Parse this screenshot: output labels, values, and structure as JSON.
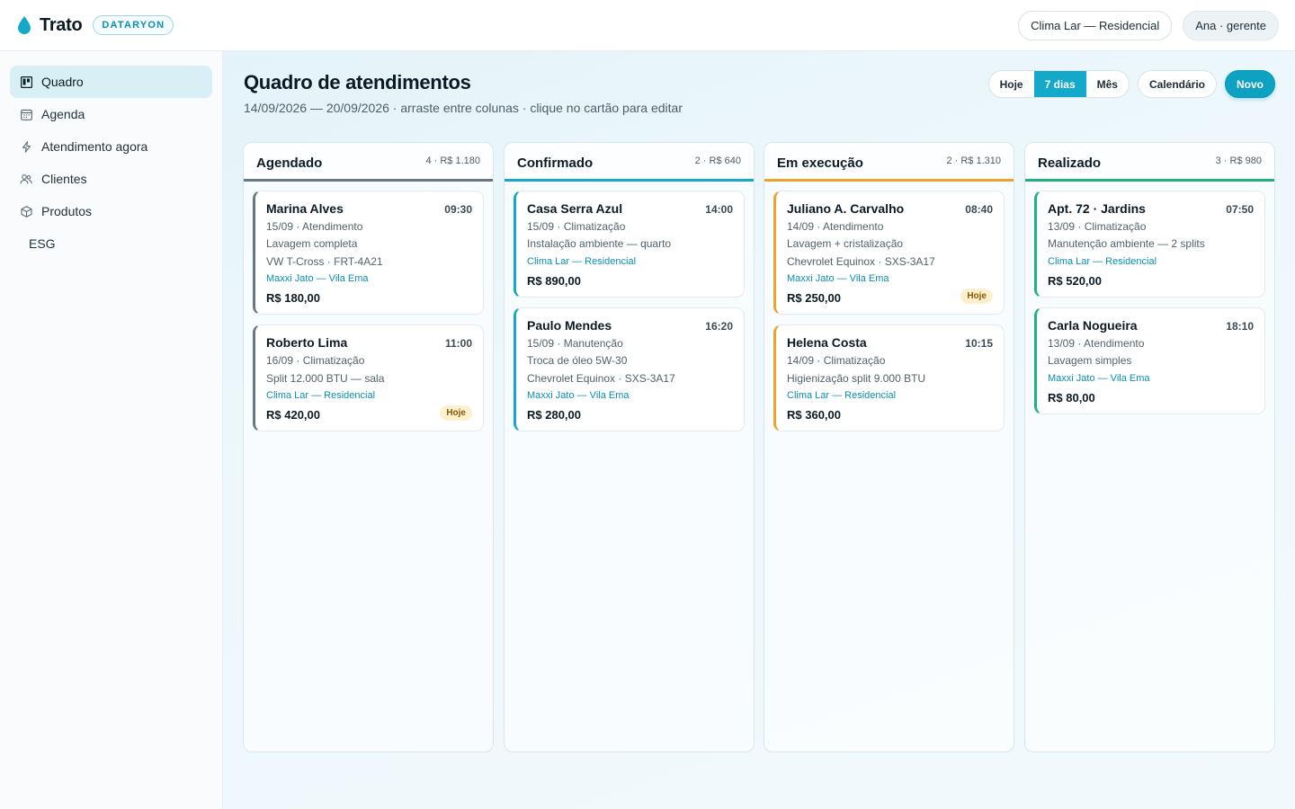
{
  "brand": {
    "name": "Trato",
    "tag": "DATARYON"
  },
  "top": {
    "workspace": "Clima Lar — Residencial",
    "user": "Ana · gerente"
  },
  "nav": [
    {
      "label": "Quadro",
      "icon": "board-icon",
      "active": true
    },
    {
      "label": "Agenda",
      "icon": "calendar-icon",
      "active": false
    },
    {
      "label": "Atendimento agora",
      "icon": "bolt-icon",
      "active": false
    },
    {
      "label": "Clientes",
      "icon": "users-icon",
      "active": false
    },
    {
      "label": "Produtos",
      "icon": "box-icon",
      "active": false
    },
    {
      "label": "ESG",
      "icon": "",
      "active": false
    }
  ],
  "page": {
    "title": "Quadro de atendimentos",
    "subtitle": "14/09/2026 — 20/09/2026 · arraste entre colunas · clique no cartão para editar"
  },
  "range": {
    "today": "Hoje",
    "week": "7 dias",
    "month": "Mês",
    "selected": "7 dias"
  },
  "actions": {
    "calendar": "Calendário",
    "new": "Novo"
  },
  "colors": {
    "agendado": "#6a7782",
    "confirmado": "#14a9c9",
    "execucao": "#f0a32a",
    "realizado": "#22b07d"
  },
  "columns": [
    {
      "name": "Agendado",
      "meta": "4 · R$ 1.180",
      "cards": [
        {
          "name": "Marina Alves",
          "time": "09:30",
          "lines": [
            "15/09 · Atendimento",
            "Lavagem completa",
            "VW T-Cross · FRT-4A21"
          ],
          "loc": "Maxxi Jato — Vila Ema",
          "price": "R$ 180,00",
          "badge": ""
        },
        {
          "name": "Roberto Lima",
          "time": "11:00",
          "lines": [
            "16/09 · Climatização",
            "Split 12.000 BTU — sala"
          ],
          "loc": "Clima Lar — Residencial",
          "price": "R$ 420,00",
          "badge": "Hoje"
        }
      ]
    },
    {
      "name": "Confirmado",
      "meta": "2 · R$ 640",
      "cards": [
        {
          "name": "Casa Serra Azul",
          "time": "14:00",
          "lines": [
            "15/09 · Climatização",
            "Instalação ambiente — quarto"
          ],
          "loc": "Clima Lar — Residencial",
          "price": "R$ 890,00",
          "badge": ""
        },
        {
          "name": "Paulo Mendes",
          "time": "16:20",
          "lines": [
            "15/09 · Manutenção",
            "Troca de óleo 5W-30",
            "Chevrolet Equinox · SXS-3A17"
          ],
          "loc": "Maxxi Jato — Vila Ema",
          "price": "R$ 280,00",
          "badge": ""
        }
      ]
    },
    {
      "name": "Em execução",
      "meta": "2 · R$ 1.310",
      "cards": [
        {
          "name": "Juliano A. Carvalho",
          "time": "08:40",
          "lines": [
            "14/09 · Atendimento",
            "Lavagem + cristalização",
            "Chevrolet Equinox · SXS-3A17"
          ],
          "loc": "Maxxi Jato — Vila Ema",
          "price": "R$ 250,00",
          "badge": "Hoje"
        },
        {
          "name": "Helena Costa",
          "time": "10:15",
          "lines": [
            "14/09 · Climatização",
            "Higienização split 9.000 BTU"
          ],
          "loc": "Clima Lar — Residencial",
          "price": "R$ 360,00",
          "badge": ""
        }
      ]
    },
    {
      "name": "Realizado",
      "meta": "3 · R$ 980",
      "cards": [
        {
          "name": "Apt. 72 · Jardins",
          "time": "07:50",
          "lines": [
            "13/09 · Climatização",
            "Manutenção ambiente — 2 splits"
          ],
          "loc": "Clima Lar — Residencial",
          "price": "R$ 520,00",
          "badge": ""
        },
        {
          "name": "Carla Nogueira",
          "time": "18:10",
          "lines": [
            "13/09 · Atendimento",
            "Lavagem simples"
          ],
          "loc": "Maxxi Jato — Vila Ema",
          "price": "R$ 80,00",
          "badge": ""
        }
      ]
    }
  ]
}
